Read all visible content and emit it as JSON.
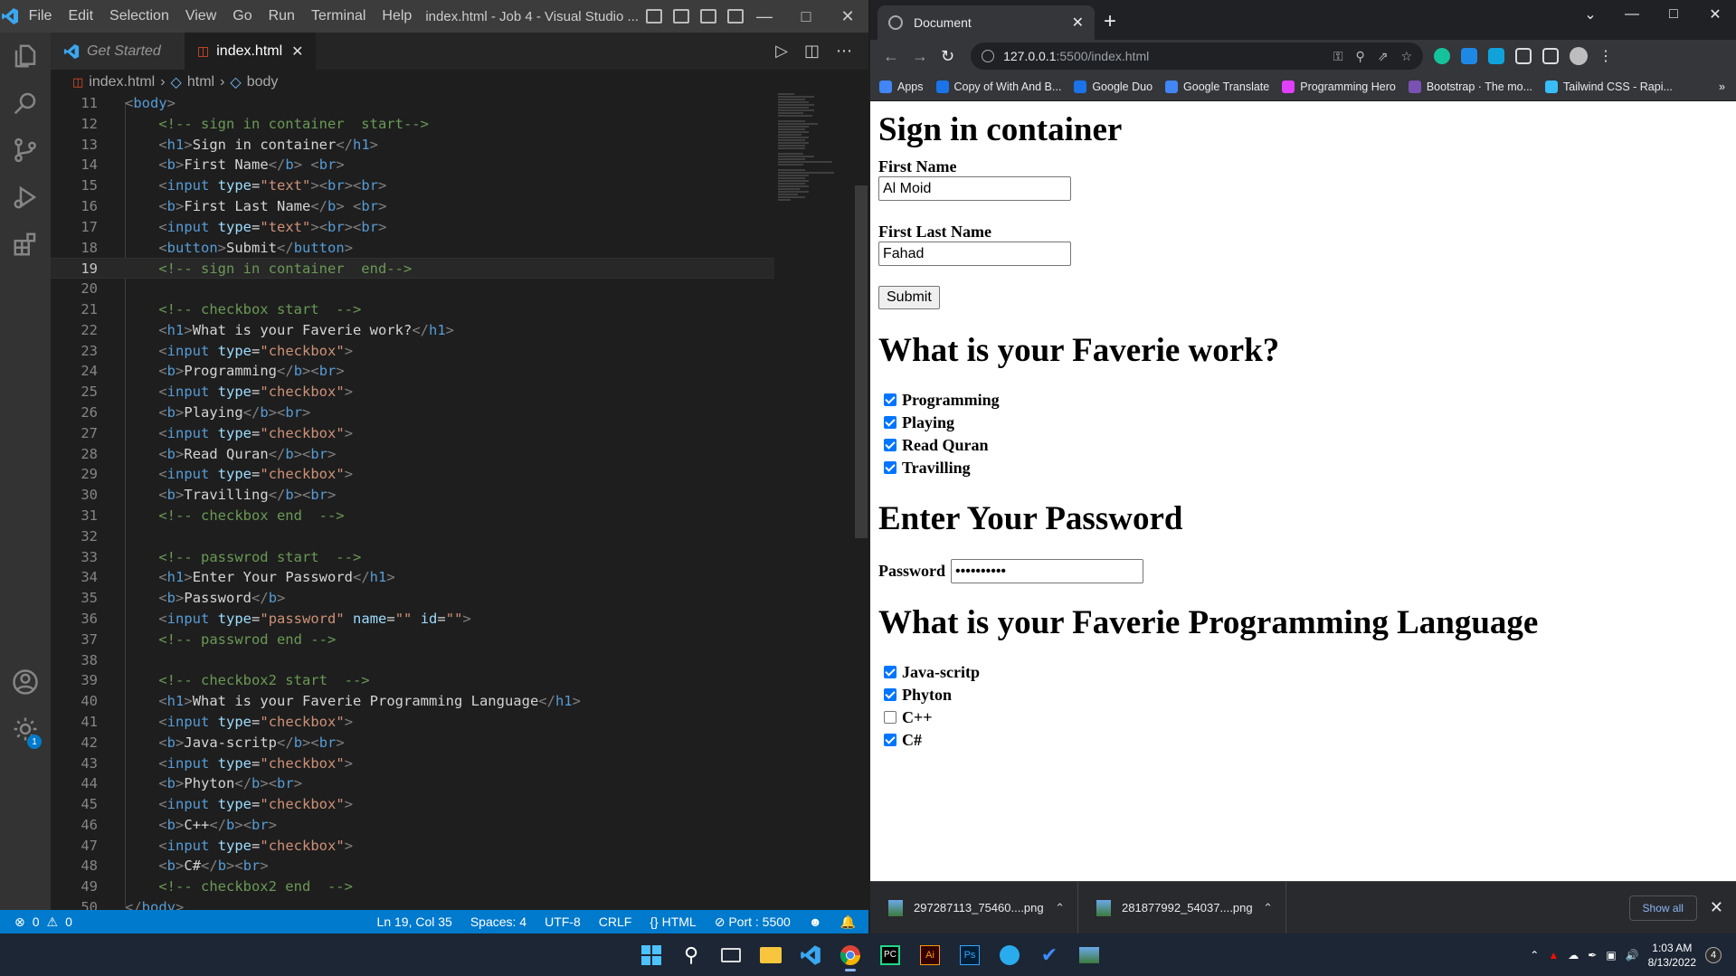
{
  "vscode": {
    "menu": [
      "File",
      "Edit",
      "Selection",
      "View",
      "Go",
      "Run",
      "Terminal",
      "Help"
    ],
    "window_title": "index.html - Job 4 - Visual Studio ...",
    "tabs": [
      {
        "label": "Get Started"
      },
      {
        "label": "index.html"
      }
    ],
    "breadcrumb": [
      "index.html",
      "html",
      "body"
    ],
    "code_lines": [
      {
        "n": "11",
        "html": "<span class=\"t-bracket\">&lt;</span><span class=\"t-tag\">body</span><span class=\"t-bracket\">&gt;</span>"
      },
      {
        "n": "12",
        "html": "    <span class=\"t-comment\">&lt;!-- sign in container  start--&gt;</span>"
      },
      {
        "n": "13",
        "html": "    <span class=\"t-bracket\">&lt;</span><span class=\"t-tag\">h1</span><span class=\"t-bracket\">&gt;</span><span class=\"t-text\">Sign in container</span><span class=\"t-bracket\">&lt;/</span><span class=\"t-tag\">h1</span><span class=\"t-bracket\">&gt;</span>"
      },
      {
        "n": "14",
        "html": "    <span class=\"t-bracket\">&lt;</span><span class=\"t-tag\">b</span><span class=\"t-bracket\">&gt;</span><span class=\"t-text\">First Name</span><span class=\"t-bracket\">&lt;/</span><span class=\"t-tag\">b</span><span class=\"t-bracket\">&gt;</span> <span class=\"t-bracket\">&lt;</span><span class=\"t-tag\">br</span><span class=\"t-bracket\">&gt;</span>"
      },
      {
        "n": "15",
        "html": "    <span class=\"t-bracket\">&lt;</span><span class=\"t-tag\">input</span> <span class=\"t-attr\">type</span><span class=\"t-text\">=</span><span class=\"t-str\">\"text\"</span><span class=\"t-bracket\">&gt;&lt;</span><span class=\"t-tag\">br</span><span class=\"t-bracket\">&gt;&lt;</span><span class=\"t-tag\">br</span><span class=\"t-bracket\">&gt;</span>"
      },
      {
        "n": "16",
        "html": "    <span class=\"t-bracket\">&lt;</span><span class=\"t-tag\">b</span><span class=\"t-bracket\">&gt;</span><span class=\"t-text\">First Last Name</span><span class=\"t-bracket\">&lt;/</span><span class=\"t-tag\">b</span><span class=\"t-bracket\">&gt;</span> <span class=\"t-bracket\">&lt;</span><span class=\"t-tag\">br</span><span class=\"t-bracket\">&gt;</span>"
      },
      {
        "n": "17",
        "html": "    <span class=\"t-bracket\">&lt;</span><span class=\"t-tag\">input</span> <span class=\"t-attr\">type</span><span class=\"t-text\">=</span><span class=\"t-str\">\"text\"</span><span class=\"t-bracket\">&gt;&lt;</span><span class=\"t-tag\">br</span><span class=\"t-bracket\">&gt;&lt;</span><span class=\"t-tag\">br</span><span class=\"t-bracket\">&gt;</span>"
      },
      {
        "n": "18",
        "html": "    <span class=\"t-bracket\">&lt;</span><span class=\"t-tag\">button</span><span class=\"t-bracket\">&gt;</span><span class=\"t-text\">Submit</span><span class=\"t-bracket\">&lt;/</span><span class=\"t-tag\">button</span><span class=\"t-bracket\">&gt;</span>"
      },
      {
        "n": "19",
        "current": true,
        "html": "    <span class=\"t-comment\">&lt;!-- sign in container  end--&gt;</span>"
      },
      {
        "n": "20",
        "html": ""
      },
      {
        "n": "21",
        "html": "    <span class=\"t-comment\">&lt;!-- checkbox start  --&gt;</span>"
      },
      {
        "n": "22",
        "html": "    <span class=\"t-bracket\">&lt;</span><span class=\"t-tag\">h1</span><span class=\"t-bracket\">&gt;</span><span class=\"t-text\">What is your Faverie work?</span><span class=\"t-bracket\">&lt;/</span><span class=\"t-tag\">h1</span><span class=\"t-bracket\">&gt;</span>"
      },
      {
        "n": "23",
        "html": "    <span class=\"t-bracket\">&lt;</span><span class=\"t-tag\">input</span> <span class=\"t-attr\">type</span><span class=\"t-text\">=</span><span class=\"t-str\">\"checkbox\"</span><span class=\"t-bracket\">&gt;</span>"
      },
      {
        "n": "24",
        "html": "    <span class=\"t-bracket\">&lt;</span><span class=\"t-tag\">b</span><span class=\"t-bracket\">&gt;</span><span class=\"t-text\">Programming</span><span class=\"t-bracket\">&lt;/</span><span class=\"t-tag\">b</span><span class=\"t-bracket\">&gt;&lt;</span><span class=\"t-tag\">br</span><span class=\"t-bracket\">&gt;</span>"
      },
      {
        "n": "25",
        "html": "    <span class=\"t-bracket\">&lt;</span><span class=\"t-tag\">input</span> <span class=\"t-attr\">type</span><span class=\"t-text\">=</span><span class=\"t-str\">\"checkbox\"</span><span class=\"t-bracket\">&gt;</span>"
      },
      {
        "n": "26",
        "html": "    <span class=\"t-bracket\">&lt;</span><span class=\"t-tag\">b</span><span class=\"t-bracket\">&gt;</span><span class=\"t-text\">Playing</span><span class=\"t-bracket\">&lt;/</span><span class=\"t-tag\">b</span><span class=\"t-bracket\">&gt;&lt;</span><span class=\"t-tag\">br</span><span class=\"t-bracket\">&gt;</span>"
      },
      {
        "n": "27",
        "html": "    <span class=\"t-bracket\">&lt;</span><span class=\"t-tag\">input</span> <span class=\"t-attr\">type</span><span class=\"t-text\">=</span><span class=\"t-str\">\"checkbox\"</span><span class=\"t-bracket\">&gt;</span>"
      },
      {
        "n": "28",
        "html": "    <span class=\"t-bracket\">&lt;</span><span class=\"t-tag\">b</span><span class=\"t-bracket\">&gt;</span><span class=\"t-text\">Read Quran</span><span class=\"t-bracket\">&lt;/</span><span class=\"t-tag\">b</span><span class=\"t-bracket\">&gt;&lt;</span><span class=\"t-tag\">br</span><span class=\"t-bracket\">&gt;</span>"
      },
      {
        "n": "29",
        "html": "    <span class=\"t-bracket\">&lt;</span><span class=\"t-tag\">input</span> <span class=\"t-attr\">type</span><span class=\"t-text\">=</span><span class=\"t-str\">\"checkbox\"</span><span class=\"t-bracket\">&gt;</span>"
      },
      {
        "n": "30",
        "html": "    <span class=\"t-bracket\">&lt;</span><span class=\"t-tag\">b</span><span class=\"t-bracket\">&gt;</span><span class=\"t-text\">Travilling</span><span class=\"t-bracket\">&lt;/</span><span class=\"t-tag\">b</span><span class=\"t-bracket\">&gt;&lt;</span><span class=\"t-tag\">br</span><span class=\"t-bracket\">&gt;</span>"
      },
      {
        "n": "31",
        "html": "    <span class=\"t-comment\">&lt;!-- checkbox end  --&gt;</span>"
      },
      {
        "n": "32",
        "html": ""
      },
      {
        "n": "33",
        "html": "    <span class=\"t-comment\">&lt;!-- passwrod start  --&gt;</span>"
      },
      {
        "n": "34",
        "html": "    <span class=\"t-bracket\">&lt;</span><span class=\"t-tag\">h1</span><span class=\"t-bracket\">&gt;</span><span class=\"t-text\">Enter Your Password</span><span class=\"t-bracket\">&lt;/</span><span class=\"t-tag\">h1</span><span class=\"t-bracket\">&gt;</span>"
      },
      {
        "n": "35",
        "html": "    <span class=\"t-bracket\">&lt;</span><span class=\"t-tag\">b</span><span class=\"t-bracket\">&gt;</span><span class=\"t-text\">Password</span><span class=\"t-bracket\">&lt;/</span><span class=\"t-tag\">b</span><span class=\"t-bracket\">&gt;</span>"
      },
      {
        "n": "36",
        "html": "    <span class=\"t-bracket\">&lt;</span><span class=\"t-tag\">input</span> <span class=\"t-attr\">type</span><span class=\"t-text\">=</span><span class=\"t-str\">\"password\"</span> <span class=\"t-attr\">name</span><span class=\"t-text\">=</span><span class=\"t-str\">\"\"</span> <span class=\"t-attr\">id</span><span class=\"t-text\">=</span><span class=\"t-str\">\"\"</span><span class=\"t-bracket\">&gt;</span>"
      },
      {
        "n": "37",
        "html": "    <span class=\"t-comment\">&lt;!-- passwrod end --&gt;</span>"
      },
      {
        "n": "38",
        "html": ""
      },
      {
        "n": "39",
        "html": "    <span class=\"t-comment\">&lt;!-- checkbox2 start  --&gt;</span>"
      },
      {
        "n": "40",
        "html": "    <span class=\"t-bracket\">&lt;</span><span class=\"t-tag\">h1</span><span class=\"t-bracket\">&gt;</span><span class=\"t-text\">What is your Faverie Programming Language</span><span class=\"t-bracket\">&lt;/</span><span class=\"t-tag\">h1</span><span class=\"t-bracket\">&gt;</span>"
      },
      {
        "n": "41",
        "html": "    <span class=\"t-bracket\">&lt;</span><span class=\"t-tag\">input</span> <span class=\"t-attr\">type</span><span class=\"t-text\">=</span><span class=\"t-str\">\"checkbox\"</span><span class=\"t-bracket\">&gt;</span>"
      },
      {
        "n": "42",
        "html": "    <span class=\"t-bracket\">&lt;</span><span class=\"t-tag\">b</span><span class=\"t-bracket\">&gt;</span><span class=\"t-text\">Java-scritp</span><span class=\"t-bracket\">&lt;/</span><span class=\"t-tag\">b</span><span class=\"t-bracket\">&gt;&lt;</span><span class=\"t-tag\">br</span><span class=\"t-bracket\">&gt;</span>"
      },
      {
        "n": "43",
        "html": "    <span class=\"t-bracket\">&lt;</span><span class=\"t-tag\">input</span> <span class=\"t-attr\">type</span><span class=\"t-text\">=</span><span class=\"t-str\">\"checkbox\"</span><span class=\"t-bracket\">&gt;</span>"
      },
      {
        "n": "44",
        "html": "    <span class=\"t-bracket\">&lt;</span><span class=\"t-tag\">b</span><span class=\"t-bracket\">&gt;</span><span class=\"t-text\">Phyton</span><span class=\"t-bracket\">&lt;/</span><span class=\"t-tag\">b</span><span class=\"t-bracket\">&gt;&lt;</span><span class=\"t-tag\">br</span><span class=\"t-bracket\">&gt;</span>"
      },
      {
        "n": "45",
        "html": "    <span class=\"t-bracket\">&lt;</span><span class=\"t-tag\">input</span> <span class=\"t-attr\">type</span><span class=\"t-text\">=</span><span class=\"t-str\">\"checkbox\"</span><span class=\"t-bracket\">&gt;</span>"
      },
      {
        "n": "46",
        "html": "    <span class=\"t-bracket\">&lt;</span><span class=\"t-tag\">b</span><span class=\"t-bracket\">&gt;</span><span class=\"t-text\">C++</span><span class=\"t-bracket\">&lt;/</span><span class=\"t-tag\">b</span><span class=\"t-bracket\">&gt;&lt;</span><span class=\"t-tag\">br</span><span class=\"t-bracket\">&gt;</span>"
      },
      {
        "n": "47",
        "html": "    <span class=\"t-bracket\">&lt;</span><span class=\"t-tag\">input</span> <span class=\"t-attr\">type</span><span class=\"t-text\">=</span><span class=\"t-str\">\"checkbox\"</span><span class=\"t-bracket\">&gt;</span>"
      },
      {
        "n": "48",
        "html": "    <span class=\"t-bracket\">&lt;</span><span class=\"t-tag\">b</span><span class=\"t-bracket\">&gt;</span><span class=\"t-text\">C#</span><span class=\"t-bracket\">&lt;/</span><span class=\"t-tag\">b</span><span class=\"t-bracket\">&gt;&lt;</span><span class=\"t-tag\">br</span><span class=\"t-bracket\">&gt;</span>"
      },
      {
        "n": "49",
        "html": "    <span class=\"t-comment\">&lt;!-- checkbox2 end  --&gt;</span>"
      },
      {
        "n": "50",
        "html": "<span class=\"t-bracket\">&lt;/</span><span class=\"t-tag\">body</span><span class=\"t-bracket\">&gt;</span>"
      }
    ],
    "status": {
      "errors": "0",
      "warnings": "0",
      "position": "Ln 19, Col 35",
      "spaces": "Spaces: 4",
      "encoding": "UTF-8",
      "eol": "CRLF",
      "language": "HTML",
      "port": "Port : 5500"
    },
    "accounts_badge": "1"
  },
  "chrome": {
    "tab_title": "Document",
    "url_host": "127.0.0.1",
    "url_path": ":5500/index.html",
    "bookmarks": [
      {
        "label": "Apps",
        "color": "#4285f4"
      },
      {
        "label": "Copy of With And B...",
        "color": "#1a73e8"
      },
      {
        "label": "Google Duo",
        "color": "#1a73e8"
      },
      {
        "label": "Google Translate",
        "color": "#4285f4"
      },
      {
        "label": "Programming Hero",
        "color": "#e040fb"
      },
      {
        "label": "Bootstrap · The mo...",
        "color": "#7952b3"
      },
      {
        "label": "Tailwind CSS - Rapi...",
        "color": "#38bdf8"
      }
    ],
    "page": {
      "h1_signin": "Sign in container",
      "label_first_name": "First Name",
      "value_first_name": "Al Moid",
      "label_last_name": "First Last Name",
      "value_last_name": "Fahad",
      "submit": "Submit",
      "h1_work": "What is your Faverie work?",
      "work_options": [
        {
          "label": "Programming",
          "checked": true
        },
        {
          "label": "Playing",
          "checked": true
        },
        {
          "label": "Read Quran",
          "checked": true
        },
        {
          "label": "Travilling",
          "checked": true
        }
      ],
      "h1_password": "Enter Your Password",
      "label_password": "Password",
      "value_password": "••••••••••",
      "h1_language": "What is your Faverie Programming Language",
      "language_options": [
        {
          "label": "Java-scritp",
          "checked": true
        },
        {
          "label": "Phyton",
          "checked": true
        },
        {
          "label": "C++",
          "checked": false
        },
        {
          "label": "C#",
          "checked": true
        }
      ]
    },
    "downloads": [
      {
        "name": "297287113_75460....png"
      },
      {
        "name": "281877992_54037....png"
      }
    ],
    "show_all": "Show all"
  },
  "taskbar": {
    "time": "1:03 AM",
    "date": "8/13/2022",
    "notification_count": "4"
  }
}
